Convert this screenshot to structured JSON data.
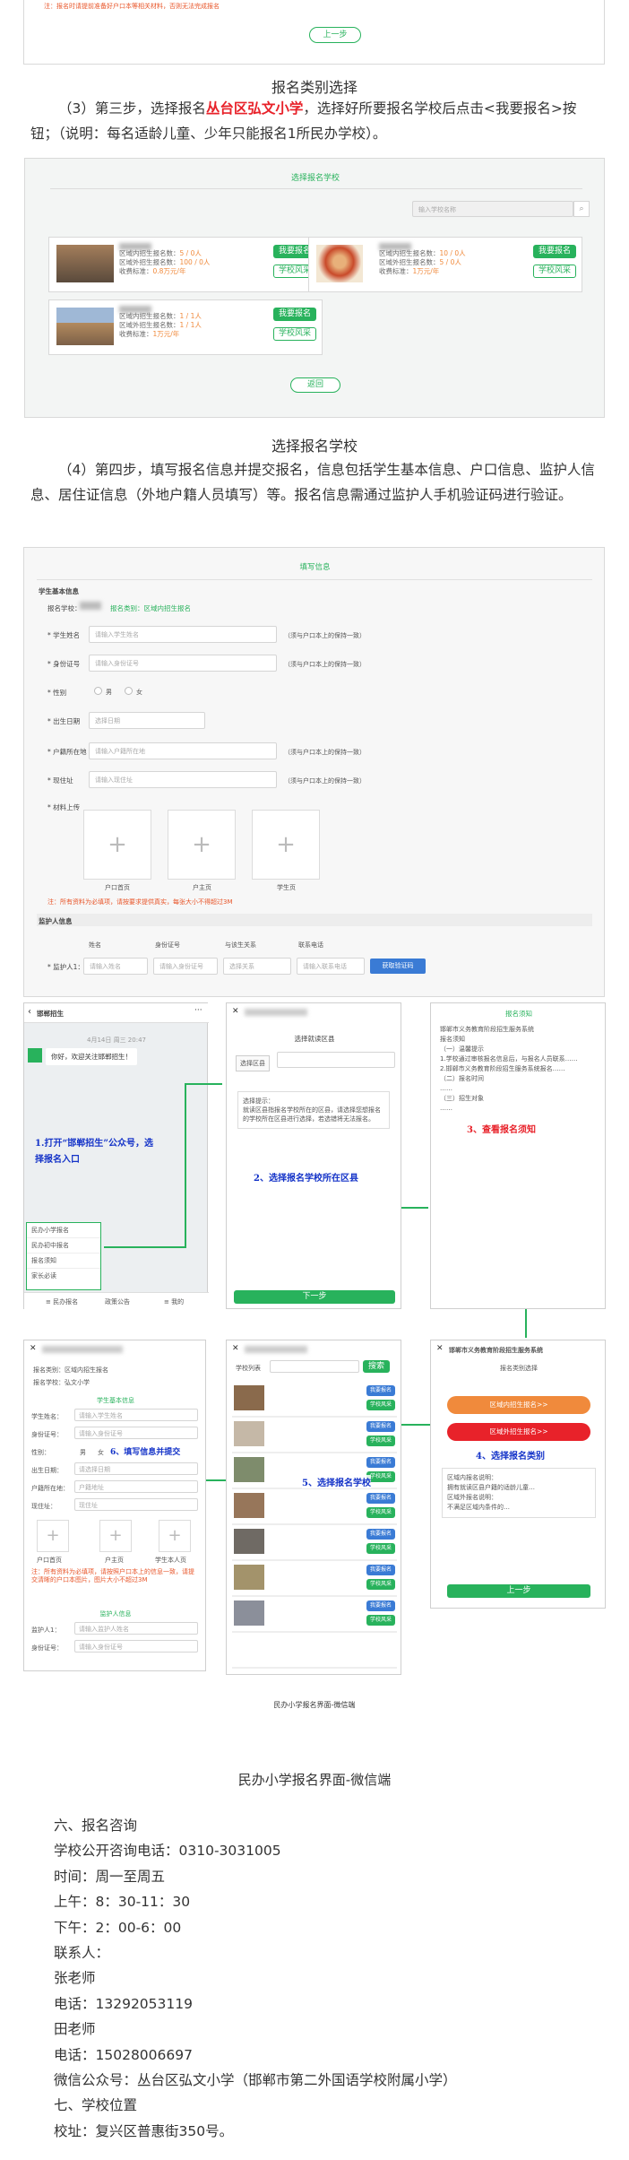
{
  "top": {
    "warning": "注：报名时请提前准备好户口本等相关材料，否则无法完成报名",
    "back_button": "上一步"
  },
  "captions": {
    "cat": "报名类别选择",
    "school": "选择报名学校",
    "wx_small": "民办小学报名界面-微信端",
    "wx": "民办小学报名界面-微信端"
  },
  "p3": {
    "pre": "（3）第三步，选择报名",
    "highlight": "丛台区弘文小学",
    "post": "，选择好所要报名学校后点击<我要报名>按钮；（说明：每名适龄儿童、少年只能报名1所民办学校）。"
  },
  "p4": "（4）第四步，填写报名信息并提交报名，信息包括学生基本信息、户口信息、监护人信息、居住证信息（外地户籍人员填写）等。报名信息需通过监护人手机验证码进行验证。",
  "school_list": {
    "title": "选择报名学校",
    "search_placeholder": "输入学校名称",
    "return": "返回",
    "apply": "我要报名",
    "style": "学校风采",
    "cards": [
      {
        "l1": "区域内招生报名数：",
        "v1": "5 / 0人",
        "l2": "区域外招生报名数：",
        "v2": "100 / 0人",
        "l3": "收费标准：",
        "v3": "0.8万元/年"
      },
      {
        "l1": "区域内招生报名数：",
        "v1": "10 / 0人",
        "l2": "区域外招生报名数：",
        "v2": "5 / 0人",
        "l3": "收费标准：",
        "v3": "1万元/年"
      },
      {
        "l1": "区域内招生报名数：",
        "v1": "1 / 1人",
        "l2": "区域外招生报名数：",
        "v2": "1 / 1人",
        "l3": "收费标准：",
        "v3": "1万元/年"
      }
    ]
  },
  "form": {
    "title": "填写信息",
    "section_student": "学生基本信息",
    "school_label": "报名学校：",
    "school_value": "报名类别：区域内招生报名",
    "fields": [
      {
        "label": "* 学生姓名",
        "ph": "请输入学生姓名",
        "hint": "（须与户口本上的保持一致）"
      },
      {
        "label": "* 身份证号",
        "ph": "请输入身份证号",
        "hint": "（须与户口本上的保持一致）"
      },
      {
        "label": "* 性别",
        "ph": "",
        "hint": ""
      },
      {
        "label": "* 出生日期",
        "ph": "选择日期",
        "hint": ""
      },
      {
        "label": "* 户籍所在地",
        "ph": "请输入户籍所在地",
        "hint": "（须与户口本上的保持一致）"
      },
      {
        "label": "* 现住址",
        "ph": "请输入现住址",
        "hint": "（须与户口本上的保持一致）"
      }
    ],
    "male": "男",
    "female": "女",
    "upload_label": "* 材料上传",
    "uploads": [
      "户口首页",
      "户主页",
      "学生页"
    ],
    "note": "注：所有资料为必填项，请按要求提供真实，每张大小不得超过3M",
    "section_guardian": "监护人信息",
    "guardian_cols": [
      "姓名",
      "身份证号",
      "与该生关系",
      "联系电话"
    ],
    "guardian_label": "* 监护人1：",
    "guardian_ph": [
      "请输入姓名",
      "请输入身份证号",
      "选择关系",
      "请输入联系电话"
    ],
    "code_btn": "获取验证码"
  },
  "mobile": {
    "p1_title": "邯郸招生",
    "p1_time": "4月14日 周三 20:47",
    "p1_msg": "你好，欢迎关注邯郸招生！",
    "menu": [
      "民办小学报名",
      "民办初中报名",
      "报名须知",
      "家长必读"
    ],
    "tabs": [
      "≡ 民办报名",
      "政策公告",
      "≡ 我的"
    ],
    "s1": "1.打开“邯郸招生”公众号，选择报名入口",
    "p2_title": "选择就读区县",
    "p2_field": "选择区县",
    "p2_box": "选择提示：\n就读区县指报名学校所在的区县，请选择您想报名的学校所在区县进行选择，若选错将无法报名。",
    "s2": "2、选择报名学校所在区县",
    "next": "下一步",
    "p3_title": "报名须知",
    "p3_text": "邯郸市义务教育阶段招生服务系统\n报名须知\n（一）温馨提示\n1.学校通过审核报名信息后，与报名人员联系……\n2.邯郸市义务教育阶段招生服务系统报名……\n（二）报名时间\n……\n（三）招生对象\n……",
    "s3": "3、查看报名须知",
    "p4_header": "邯郸市义务教育阶段招生服务系统",
    "p4_title": "报名类别选择",
    "p4_btn1": "区域内招生报名>>",
    "p4_btn2": "区域外招生报名>>",
    "p4_text": "区域内报名说明：\n拥有就读区县户籍的适龄儿童…\n区域外报名说明：\n不满足区域内条件的…",
    "s4": "4、选择报名类别",
    "prev": "上一步",
    "p5_search": "学校列表",
    "p5_go": "搜索",
    "s5": "5、选择报名学校",
    "apply": "我要报名",
    "style": "学校风采",
    "p6_type": "报名类别：区域内招生报名",
    "p6_school": "报名学校：弘文小学",
    "p6_section": "学生基本信息",
    "p6_fields": [
      "学生姓名：",
      "身份证号：",
      "性别：",
      "出生日期：",
      "户籍所在地：",
      "现住址："
    ],
    "p6_ph": [
      "请输入学生姓名",
      "请输入身份证号",
      "",
      "请选择日期",
      "户籍地址",
      "现住址"
    ],
    "male": "男",
    "female": "女",
    "p6_uploads": [
      "户口首页",
      "户主页",
      "学生本人页"
    ],
    "p6_note": "注：所有资料为必填项，请按照户口本上的信息一致，请提交清晰的户口本图片，图片大小不超过3M",
    "p6_guardian": "监护人信息",
    "p6_g": [
      "监护人1：",
      "身份证号："
    ],
    "p6_gph": [
      "请输入监护人姓名",
      "请输入身份证号"
    ],
    "s6": "6、填写信息并提交"
  },
  "consult": {
    "h6": "六、报名咨询",
    "phone_line": "学校公开咨询电话：0310-3031005",
    "time": "时间：周一至周五",
    "am": "上午：8：30-11：30",
    "pm": "下午：2：00-6：00",
    "contact": "联系人：",
    "t1": "张老师",
    "t1_phone": "电话：13292053119",
    "t2": "田老师",
    "t2_phone": "电话：15028006697",
    "wechat": "微信公众号：丛台区弘文小学（邯郸市第二外国语学校附属小学）",
    "h7": "七、学校位置",
    "addr": "校址：复兴区普惠街350号。"
  },
  "colors": {
    "green": "#28b25c",
    "orange": "#f08a3c",
    "red": "#e8222a",
    "blue": "#1433c8"
  }
}
